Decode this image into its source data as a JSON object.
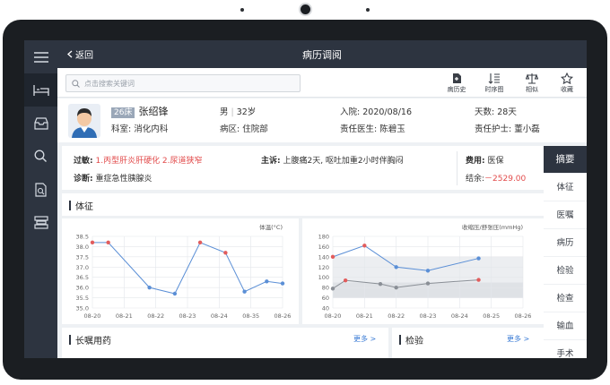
{
  "topbar": {
    "back_label": "返回",
    "title": "病历调阅"
  },
  "search": {
    "placeholder": "点击搜索关键词"
  },
  "toolbar": [
    {
      "icon": "history-record-icon",
      "label": "病历史"
    },
    {
      "icon": "timeline-sort-icon",
      "label": "时序图"
    },
    {
      "icon": "scale-compare-icon",
      "label": "相似"
    },
    {
      "icon": "star-icon",
      "label": "收藏"
    }
  ],
  "patient": {
    "bed": "26床",
    "name": "张绍锋",
    "gender": "男",
    "age": "32岁",
    "admit_label": "入院:",
    "admit_date": "2020/08/16",
    "days_label": "天数:",
    "days": "28天",
    "dept_label": "科室:",
    "dept": "消化内科",
    "ward_label": "病区:",
    "ward": "住院部",
    "doctor_label": "责任医生:",
    "doctor": "陈碧玉",
    "nurse_label": "责任护士:",
    "nurse": "董小磊"
  },
  "summary": {
    "allergy_label": "过敏:",
    "allergy_values": "1.丙型肝炎肝硬化  2.尿道狭窄",
    "complaint_label": "主诉:",
    "complaint": "上腹痛2天, 呕吐加重2小时伴胸闷",
    "fee_label": "费用:",
    "fee_type": "医保",
    "diag_label": "诊断:",
    "diagnosis": "重症急性胰腺炎",
    "balance_label": "结余:",
    "balance": "－2529.00"
  },
  "right_tabs": [
    "摘要",
    "体征",
    "医嘱",
    "病历",
    "检验",
    "检查",
    "输血",
    "手术"
  ],
  "sections": {
    "vitals_title": "体征",
    "orders_title": "长嘱用药",
    "lab_title": "检验",
    "more_label": "更多 >"
  },
  "chart_data": [
    {
      "type": "line",
      "title": "体温(°C)",
      "categories": [
        "08-20",
        "08-21",
        "08-22",
        "08-23",
        "08-24",
        "08-35",
        "08-26"
      ],
      "x": [
        0,
        0.5,
        1.8,
        2.6,
        3.4,
        4.2,
        4.8,
        5.5,
        6.0
      ],
      "series": [
        {
          "values": [
            38.2,
            38.2,
            36.0,
            35.7,
            38.2,
            37.7,
            35.8,
            36.3,
            36.2
          ]
        }
      ],
      "highlight": [
        true,
        true,
        false,
        false,
        true,
        true,
        false,
        false,
        false
      ],
      "ylim": [
        35.0,
        38.5
      ],
      "yticks": [
        38.5,
        38.0,
        37.5,
        37.0,
        36.5,
        36.0,
        35.5,
        35.0
      ],
      "colors": {
        "line": "#5b8fd6",
        "point": "#5b8fd6",
        "highlight": "#e25c5c"
      }
    },
    {
      "type": "line",
      "title": "收缩压/舒张压(mmHg)",
      "categories": [
        "08-20",
        "08-21",
        "08-22",
        "08-23",
        "08-24",
        "08-25",
        "08-26"
      ],
      "series": [
        {
          "name": "收缩压",
          "x": [
            0,
            1,
            2,
            3,
            4.6
          ],
          "values": [
            140,
            162,
            120,
            113,
            137
          ],
          "pointColors": [
            "#e25c5c",
            "#e25c5c",
            "#5b8fd6",
            "#5b8fd6",
            "#5b8fd6"
          ],
          "color": "#5b8fd6"
        },
        {
          "name": "舒张压",
          "x": [
            0,
            0.4,
            1.5,
            2.0,
            3.0,
            4.6
          ],
          "values": [
            78,
            94,
            87,
            80,
            88,
            95
          ],
          "pointColors": [
            "#8a8f96",
            "#e25c5c",
            "#8a8f96",
            "#8a8f96",
            "#8a8f96",
            "#e25c5c"
          ],
          "color": "#8a8f96"
        }
      ],
      "bands": [
        [
          90,
          140
        ],
        [
          60,
          90
        ]
      ],
      "ylim": [
        40,
        180
      ],
      "yticks": [
        180,
        160,
        140,
        120,
        100,
        80,
        60,
        40
      ],
      "colors": {
        "band1": "#eceef1",
        "band2": "#dfe2e6"
      }
    }
  ]
}
